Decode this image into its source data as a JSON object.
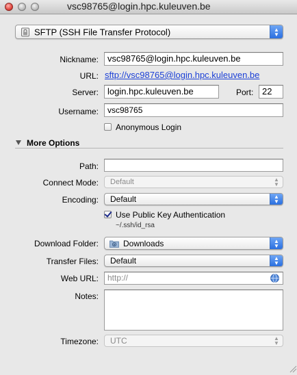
{
  "window": {
    "title": "vsc98765@login.hpc.kuleuven.be"
  },
  "protocol": {
    "selected": "SFTP (SSH File Transfer Protocol)"
  },
  "form": {
    "nickname_label": "Nickname:",
    "nickname_value": "vsc98765@login.hpc.kuleuven.be",
    "url_label": "URL:",
    "url_value": "sftp://vsc98765@login.hpc.kuleuven.be",
    "server_label": "Server:",
    "server_value": "login.hpc.kuleuven.be",
    "port_label": "Port:",
    "port_value": "22",
    "username_label": "Username:",
    "username_value": "vsc98765",
    "anonymous_label": "Anonymous Login",
    "anonymous_checked": false
  },
  "more_options": {
    "header": "More Options",
    "path_label": "Path:",
    "path_value": "",
    "connect_mode_label": "Connect Mode:",
    "connect_mode_value": "Default",
    "encoding_label": "Encoding:",
    "encoding_value": "Default",
    "public_key_label": "Use Public Key Authentication",
    "public_key_checked": true,
    "key_path": "~/.ssh/id_rsa",
    "download_folder_label": "Download Folder:",
    "download_folder_value": "Downloads",
    "transfer_files_label": "Transfer Files:",
    "transfer_files_value": "Default",
    "web_url_label": "Web URL:",
    "web_url_placeholder": "http://",
    "notes_label": "Notes:",
    "notes_value": "",
    "timezone_label": "Timezone:",
    "timezone_value": "UTC"
  },
  "icons": {
    "lock": "lock-icon",
    "folder": "folder-icon",
    "globe": "globe-icon"
  },
  "colors": {
    "accent": "#2a6fe0",
    "link": "#1a3fd6"
  }
}
